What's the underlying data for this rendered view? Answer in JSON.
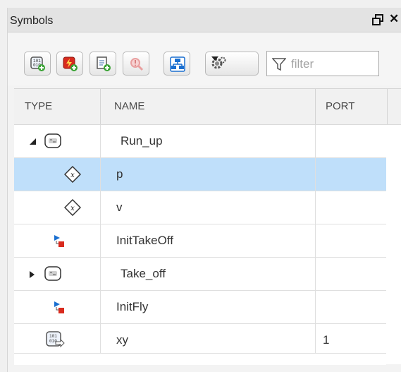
{
  "panel": {
    "title": "Symbols",
    "close_glyph": "✕"
  },
  "toolbar": {
    "buttons": [
      {
        "icon": "add-data-icon"
      },
      {
        "icon": "add-event-icon"
      },
      {
        "icon": "add-message-icon"
      },
      {
        "icon": "symbol-inspector-icon",
        "disabled": true
      },
      {
        "icon": "hierarchy-icon"
      },
      {
        "icon": "settings-dropdown-icon"
      }
    ],
    "filter": {
      "placeholder": "filter",
      "value": ""
    }
  },
  "table": {
    "columns": [
      "TYPE",
      "NAME",
      "PORT"
    ],
    "rows": [
      {
        "type_icon": "state-icon",
        "expand": "expanded",
        "name": "Run_up",
        "port": "",
        "selected": false
      },
      {
        "type_icon": "local-variable-icon",
        "name": "p",
        "port": "",
        "selected": true
      },
      {
        "type_icon": "local-variable-icon",
        "name": "v",
        "port": "",
        "selected": false
      },
      {
        "type_icon": "action-message-icon",
        "name": "InitTakeOff",
        "port": "",
        "selected": false
      },
      {
        "type_icon": "state-icon",
        "expand": "collapsed",
        "name": "Take_off",
        "port": "",
        "selected": false
      },
      {
        "type_icon": "action-message-icon",
        "name": "InitFly",
        "port": "",
        "selected": false
      },
      {
        "type_icon": "output-data-icon",
        "name": "xy",
        "port": "1",
        "selected": false
      }
    ]
  },
  "colors": {
    "selection": "#bfdffa",
    "accent_red": "#d92b1e",
    "accent_blue": "#1a6fd0"
  }
}
